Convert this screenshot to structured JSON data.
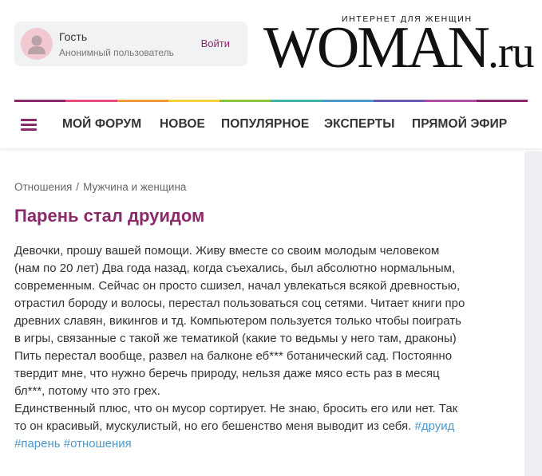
{
  "user": {
    "name": "Гость",
    "subtitle": "Анонимный пользователь",
    "login_label": "Войти"
  },
  "logo": {
    "tagline": "ИНТЕРНЕТ ДЛЯ ЖЕНЩИН",
    "main": "WOMAN",
    "suffix": ".ru"
  },
  "stripe_colors": [
    "#8a2a6b",
    "#e94b7e",
    "#f29b38",
    "#f6d23c",
    "#8cc63f",
    "#3fb6a8",
    "#4a9acb",
    "#6a5bb5",
    "#b04ea3",
    "#8a2a6b"
  ],
  "nav": {
    "items": [
      "МОЙ ФОРУМ",
      "НОВОЕ",
      "ПОПУЛЯРНОЕ",
      "ЭКСПЕРТЫ",
      "ПРЯМОЙ ЭФИР"
    ]
  },
  "breadcrumb": [
    "Отношения",
    "Мужчина и женщина"
  ],
  "breadcrumb_sep": "/",
  "post": {
    "title": "Парень стал друидом",
    "lines": [
      "Девочки, прошу вашей помощи. Живу вместе со своим молодым человеком",
      "(нам по 20 лет) Два года назад, когда съехались, был абсолютно нормальным,",
      "современным. Сейчас он просто сшизел, начал увлекаться всякой древностью,",
      "отрастил бороду и волосы, перестал пользоваться соц сетями. Читает книги про",
      "древних славян, викингов и тд. Компьютером пользуется только чтобы поиграть",
      "в игры, связанные с такой же тематикой (какие то ведьмы у него там, драконы)",
      "Пить перестал вообще, развел на балконе еб*** ботанический сад. Постоянно",
      "твердит мне, что нужно беречь природу, нельзя даже мясо есть раз в месяц",
      "бл***, потому что это грех.",
      "Единственный плюс, что он мусор сортирует. Не знаю, бросить его или нет. Так"
    ],
    "last_line_text": "то он красивый, мускулистый, но его бешенство меня выводит из себя. ",
    "tags": [
      "#друид",
      "#парень",
      "#отношения"
    ]
  },
  "colors": {
    "accent": "#8a2a6b",
    "tag": "#4a9acb"
  }
}
